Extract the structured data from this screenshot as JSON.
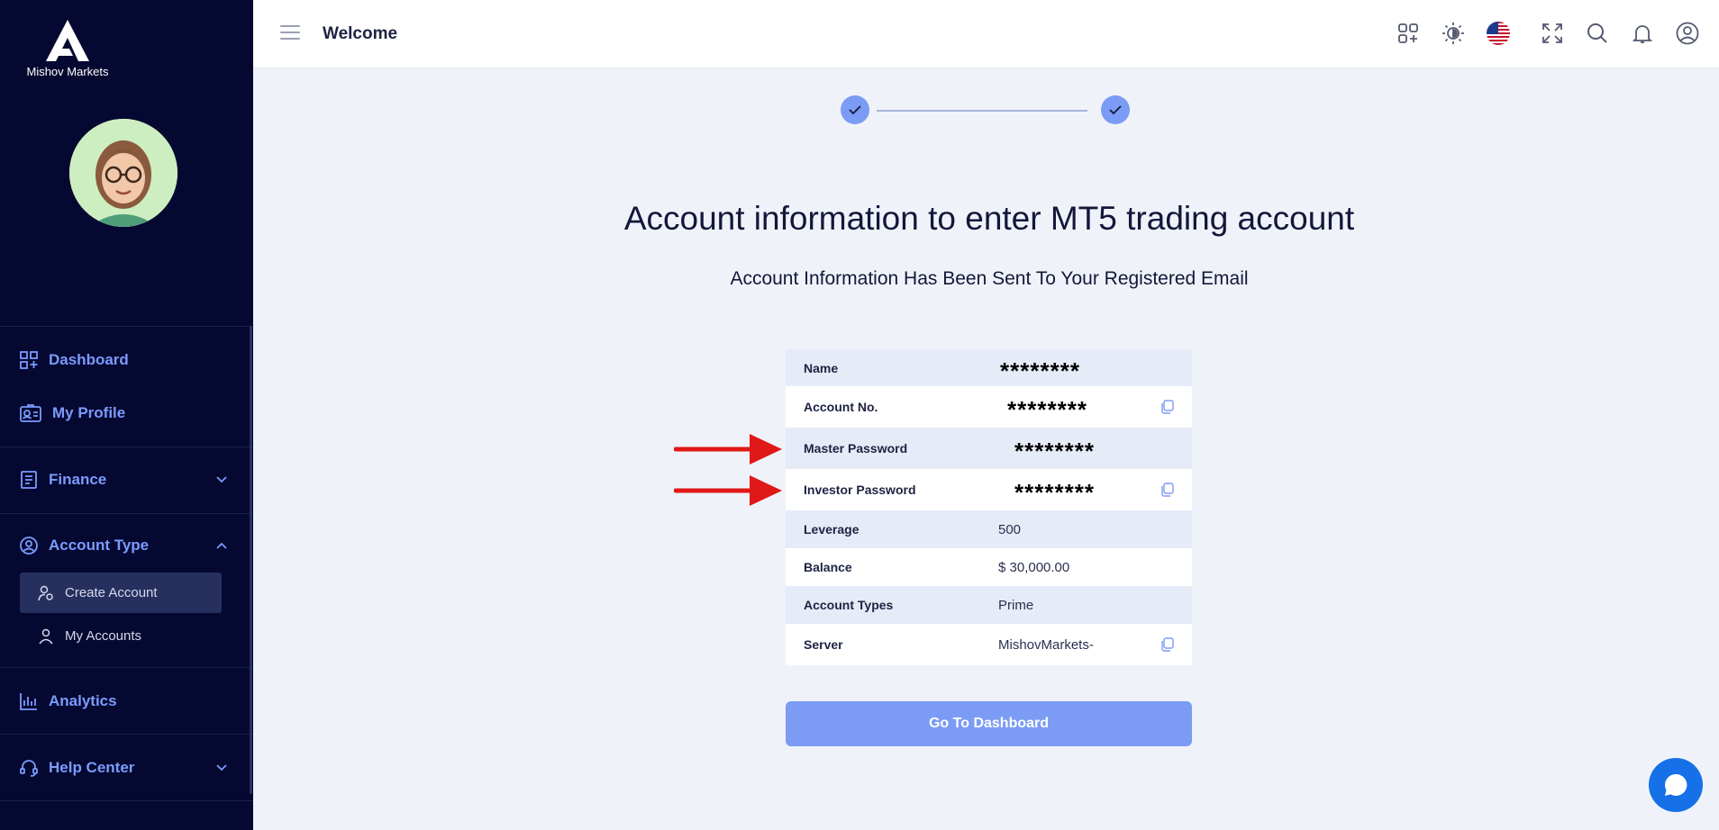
{
  "brand": {
    "name": "Mishov Markets"
  },
  "header": {
    "title": "Welcome"
  },
  "sidebar": {
    "items": [
      {
        "label": "Dashboard"
      },
      {
        "label": "My Profile"
      },
      {
        "label": "Finance"
      },
      {
        "label": "Account Type"
      },
      {
        "label": "Analytics"
      },
      {
        "label": "Help Center"
      }
    ],
    "sub_items": [
      {
        "label": "Create Account",
        "active": true
      },
      {
        "label": "My Accounts",
        "active": false
      }
    ]
  },
  "main": {
    "title": "Account information to enter MT5 trading account",
    "subtitle": "Account Information Has Been Sent To Your Registered Email",
    "rows": [
      {
        "label": "Name",
        "value": "********"
      },
      {
        "label": "Account No.",
        "value": "********"
      },
      {
        "label": "Master Password",
        "value": "********"
      },
      {
        "label": "Investor Password",
        "value": "********"
      },
      {
        "label": "Leverage",
        "value": "500"
      },
      {
        "label": "Balance",
        "value": "$ 30,000.00"
      },
      {
        "label": "Account Types",
        "value": "Prime"
      },
      {
        "label": "Server",
        "value": "MishovMarkets-"
      }
    ],
    "button_label": "Go To Dashboard"
  },
  "colors": {
    "sidebar_bg": "#050830",
    "accent": "#7b9bf5",
    "nav_text": "#7b9bff",
    "arrow": "#e01818",
    "chat": "#1670e8"
  }
}
